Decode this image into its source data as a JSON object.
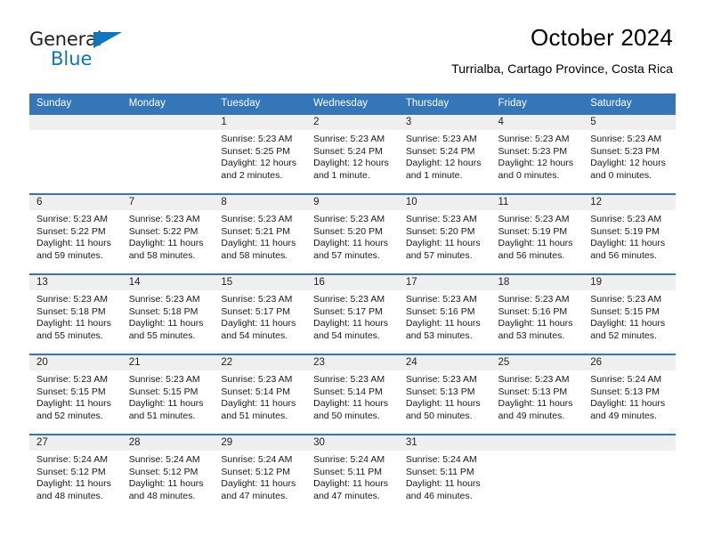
{
  "brand": {
    "name_part1": "General",
    "name_part2": "Blue",
    "accent_color": "#1274bb",
    "logo_icon": "blue-triangle"
  },
  "header": {
    "title": "October 2024",
    "subtitle": "Turrialba, Cartago Province, Costa Rica"
  },
  "theme": {
    "header_blue": "#3576b8",
    "daynum_gray": "#efefef",
    "text_black": "#000000"
  },
  "calendar": {
    "weekday_headers": [
      "Sunday",
      "Monday",
      "Tuesday",
      "Wednesday",
      "Thursday",
      "Friday",
      "Saturday"
    ],
    "weeks": [
      [
        {
          "empty": true
        },
        {
          "empty": true
        },
        {
          "day": "1",
          "sunrise": "Sunrise: 5:23 AM",
          "sunset": "Sunset: 5:25 PM",
          "daylight1": "Daylight: 12 hours",
          "daylight2": "and 2 minutes."
        },
        {
          "day": "2",
          "sunrise": "Sunrise: 5:23 AM",
          "sunset": "Sunset: 5:24 PM",
          "daylight1": "Daylight: 12 hours",
          "daylight2": "and 1 minute."
        },
        {
          "day": "3",
          "sunrise": "Sunrise: 5:23 AM",
          "sunset": "Sunset: 5:24 PM",
          "daylight1": "Daylight: 12 hours",
          "daylight2": "and 1 minute."
        },
        {
          "day": "4",
          "sunrise": "Sunrise: 5:23 AM",
          "sunset": "Sunset: 5:23 PM",
          "daylight1": "Daylight: 12 hours",
          "daylight2": "and 0 minutes."
        },
        {
          "day": "5",
          "sunrise": "Sunrise: 5:23 AM",
          "sunset": "Sunset: 5:23 PM",
          "daylight1": "Daylight: 12 hours",
          "daylight2": "and 0 minutes."
        }
      ],
      [
        {
          "day": "6",
          "sunrise": "Sunrise: 5:23 AM",
          "sunset": "Sunset: 5:22 PM",
          "daylight1": "Daylight: 11 hours",
          "daylight2": "and 59 minutes."
        },
        {
          "day": "7",
          "sunrise": "Sunrise: 5:23 AM",
          "sunset": "Sunset: 5:22 PM",
          "daylight1": "Daylight: 11 hours",
          "daylight2": "and 58 minutes."
        },
        {
          "day": "8",
          "sunrise": "Sunrise: 5:23 AM",
          "sunset": "Sunset: 5:21 PM",
          "daylight1": "Daylight: 11 hours",
          "daylight2": "and 58 minutes."
        },
        {
          "day": "9",
          "sunrise": "Sunrise: 5:23 AM",
          "sunset": "Sunset: 5:20 PM",
          "daylight1": "Daylight: 11 hours",
          "daylight2": "and 57 minutes."
        },
        {
          "day": "10",
          "sunrise": "Sunrise: 5:23 AM",
          "sunset": "Sunset: 5:20 PM",
          "daylight1": "Daylight: 11 hours",
          "daylight2": "and 57 minutes."
        },
        {
          "day": "11",
          "sunrise": "Sunrise: 5:23 AM",
          "sunset": "Sunset: 5:19 PM",
          "daylight1": "Daylight: 11 hours",
          "daylight2": "and 56 minutes."
        },
        {
          "day": "12",
          "sunrise": "Sunrise: 5:23 AM",
          "sunset": "Sunset: 5:19 PM",
          "daylight1": "Daylight: 11 hours",
          "daylight2": "and 56 minutes."
        }
      ],
      [
        {
          "day": "13",
          "sunrise": "Sunrise: 5:23 AM",
          "sunset": "Sunset: 5:18 PM",
          "daylight1": "Daylight: 11 hours",
          "daylight2": "and 55 minutes."
        },
        {
          "day": "14",
          "sunrise": "Sunrise: 5:23 AM",
          "sunset": "Sunset: 5:18 PM",
          "daylight1": "Daylight: 11 hours",
          "daylight2": "and 55 minutes."
        },
        {
          "day": "15",
          "sunrise": "Sunrise: 5:23 AM",
          "sunset": "Sunset: 5:17 PM",
          "daylight1": "Daylight: 11 hours",
          "daylight2": "and 54 minutes."
        },
        {
          "day": "16",
          "sunrise": "Sunrise: 5:23 AM",
          "sunset": "Sunset: 5:17 PM",
          "daylight1": "Daylight: 11 hours",
          "daylight2": "and 54 minutes."
        },
        {
          "day": "17",
          "sunrise": "Sunrise: 5:23 AM",
          "sunset": "Sunset: 5:16 PM",
          "daylight1": "Daylight: 11 hours",
          "daylight2": "and 53 minutes."
        },
        {
          "day": "18",
          "sunrise": "Sunrise: 5:23 AM",
          "sunset": "Sunset: 5:16 PM",
          "daylight1": "Daylight: 11 hours",
          "daylight2": "and 53 minutes."
        },
        {
          "day": "19",
          "sunrise": "Sunrise: 5:23 AM",
          "sunset": "Sunset: 5:15 PM",
          "daylight1": "Daylight: 11 hours",
          "daylight2": "and 52 minutes."
        }
      ],
      [
        {
          "day": "20",
          "sunrise": "Sunrise: 5:23 AM",
          "sunset": "Sunset: 5:15 PM",
          "daylight1": "Daylight: 11 hours",
          "daylight2": "and 52 minutes."
        },
        {
          "day": "21",
          "sunrise": "Sunrise: 5:23 AM",
          "sunset": "Sunset: 5:15 PM",
          "daylight1": "Daylight: 11 hours",
          "daylight2": "and 51 minutes."
        },
        {
          "day": "22",
          "sunrise": "Sunrise: 5:23 AM",
          "sunset": "Sunset: 5:14 PM",
          "daylight1": "Daylight: 11 hours",
          "daylight2": "and 51 minutes."
        },
        {
          "day": "23",
          "sunrise": "Sunrise: 5:23 AM",
          "sunset": "Sunset: 5:14 PM",
          "daylight1": "Daylight: 11 hours",
          "daylight2": "and 50 minutes."
        },
        {
          "day": "24",
          "sunrise": "Sunrise: 5:23 AM",
          "sunset": "Sunset: 5:13 PM",
          "daylight1": "Daylight: 11 hours",
          "daylight2": "and 50 minutes."
        },
        {
          "day": "25",
          "sunrise": "Sunrise: 5:23 AM",
          "sunset": "Sunset: 5:13 PM",
          "daylight1": "Daylight: 11 hours",
          "daylight2": "and 49 minutes."
        },
        {
          "day": "26",
          "sunrise": "Sunrise: 5:24 AM",
          "sunset": "Sunset: 5:13 PM",
          "daylight1": "Daylight: 11 hours",
          "daylight2": "and 49 minutes."
        }
      ],
      [
        {
          "day": "27",
          "sunrise": "Sunrise: 5:24 AM",
          "sunset": "Sunset: 5:12 PM",
          "daylight1": "Daylight: 11 hours",
          "daylight2": "and 48 minutes."
        },
        {
          "day": "28",
          "sunrise": "Sunrise: 5:24 AM",
          "sunset": "Sunset: 5:12 PM",
          "daylight1": "Daylight: 11 hours",
          "daylight2": "and 48 minutes."
        },
        {
          "day": "29",
          "sunrise": "Sunrise: 5:24 AM",
          "sunset": "Sunset: 5:12 PM",
          "daylight1": "Daylight: 11 hours",
          "daylight2": "and 47 minutes."
        },
        {
          "day": "30",
          "sunrise": "Sunrise: 5:24 AM",
          "sunset": "Sunset: 5:11 PM",
          "daylight1": "Daylight: 11 hours",
          "daylight2": "and 47 minutes."
        },
        {
          "day": "31",
          "sunrise": "Sunrise: 5:24 AM",
          "sunset": "Sunset: 5:11 PM",
          "daylight1": "Daylight: 11 hours",
          "daylight2": "and 46 minutes."
        },
        {
          "empty": true
        },
        {
          "empty": true
        }
      ]
    ]
  }
}
